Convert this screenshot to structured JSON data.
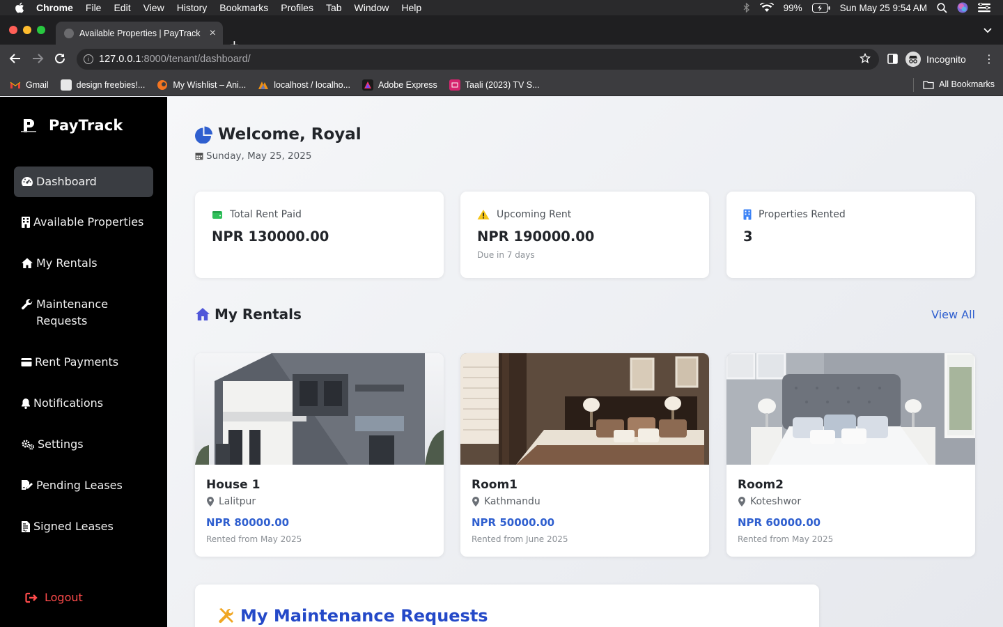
{
  "os_menubar": {
    "app": "Chrome",
    "menus": [
      "File",
      "Edit",
      "View",
      "History",
      "Bookmarks",
      "Profiles",
      "Tab",
      "Window",
      "Help"
    ],
    "battery": "99%",
    "datetime": "Sun May 25  9:54 AM"
  },
  "browser": {
    "tab_title": "Available Properties | PayTrack",
    "url_host": "127.0.0.1",
    "url_path": ":8000/tenant/dashboard/",
    "profile_label": "Incognito",
    "bookmarks": [
      {
        "label": "Gmail",
        "icon": "gmail-icon",
        "color": "#ea4335"
      },
      {
        "label": "design freebies!...",
        "icon": "page-icon",
        "color": "#e8e8e8"
      },
      {
        "label": "My Wishlist – Ani...",
        "icon": "crunchyroll-icon",
        "color": "#f47521"
      },
      {
        "label": "localhost / localho...",
        "icon": "phpmyadmin-icon",
        "color": "#f29111"
      },
      {
        "label": "Adobe Express",
        "icon": "adobe-express-icon",
        "color": "#1a1a1a"
      },
      {
        "label": "Taali (2023) TV S...",
        "icon": "tv-icon",
        "color": "#d6246e"
      }
    ],
    "all_bookmarks": "All Bookmarks"
  },
  "sidebar": {
    "brand": "PayTrack",
    "items": [
      {
        "label": "Dashboard",
        "icon": "dashboard-icon",
        "active": true
      },
      {
        "label": "Available Properties",
        "icon": "building-icon"
      },
      {
        "label": "My Rentals",
        "icon": "home-icon"
      },
      {
        "label": "Maintenance Requests",
        "icon": "wrench-icon"
      },
      {
        "label": "Rent Payments",
        "icon": "credit-card-icon"
      },
      {
        "label": "Notifications",
        "icon": "bell-icon"
      },
      {
        "label": "Settings",
        "icon": "gears-icon"
      },
      {
        "label": "Pending Leases",
        "icon": "file-signature-icon"
      },
      {
        "label": "Signed Leases",
        "icon": "file-contract-icon"
      }
    ],
    "logout": "Logout"
  },
  "header": {
    "welcome": "Welcome, Royal",
    "date": "Sunday, May 25, 2025"
  },
  "stats": [
    {
      "label": "Total Rent Paid",
      "value": "NPR 130000.00",
      "sub": "",
      "icon": "wallet-icon",
      "color": "#2fbf5a"
    },
    {
      "label": "Upcoming Rent",
      "value": "NPR 190000.00",
      "sub": "Due in 7 days",
      "icon": "warning-icon",
      "color": "#f5c518"
    },
    {
      "label": "Properties Rented",
      "value": "3",
      "sub": "",
      "icon": "building-icon",
      "color": "#3b82f6"
    }
  ],
  "rentals_section": {
    "title": "My Rentals",
    "view_all": "View All",
    "items": [
      {
        "name": "House 1",
        "location": "Lalitpur",
        "price": "NPR 80000.00",
        "since": "Rented from May 2025"
      },
      {
        "name": "Room1",
        "location": "Kathmandu",
        "price": "NPR 50000.00",
        "since": "Rented from June 2025"
      },
      {
        "name": "Room2",
        "location": "Koteshwor",
        "price": "NPR 60000.00",
        "since": "Rented from May 2025"
      }
    ]
  },
  "maintenance_section": {
    "title": "My Maintenance Requests"
  },
  "colors": {
    "accent": "#2f5fcf",
    "sidebar_bg": "#000000",
    "active_item_bg": "#3a3d42",
    "logout": "#ff4b4b"
  }
}
